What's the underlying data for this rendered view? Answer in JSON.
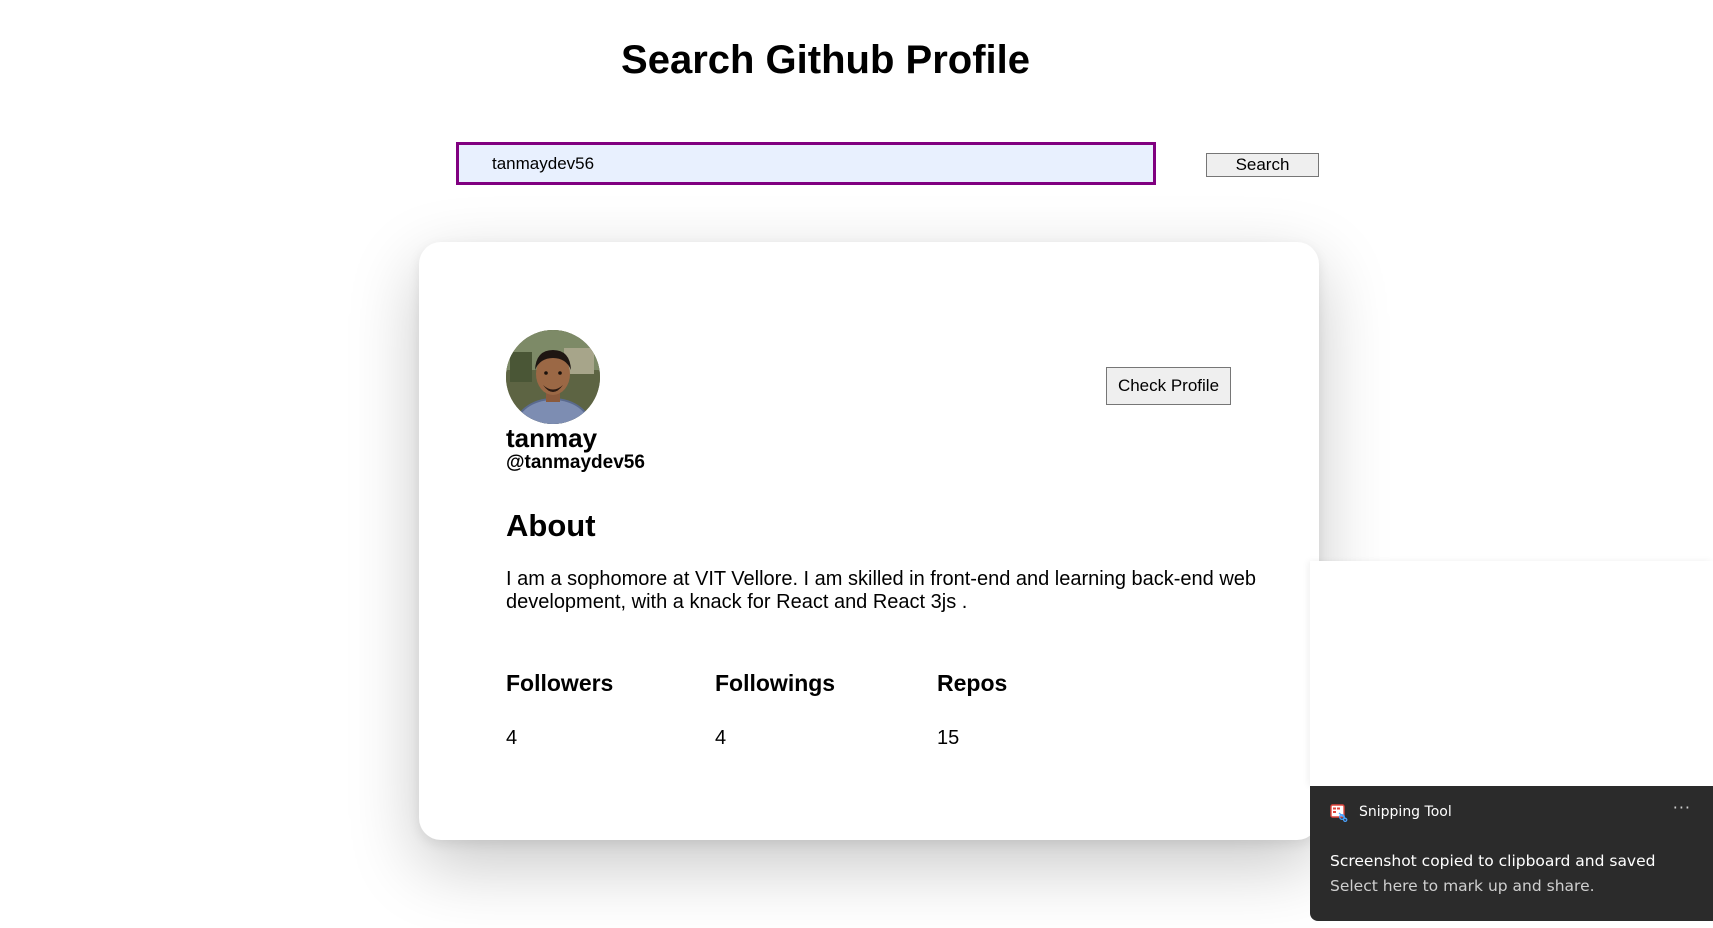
{
  "page": {
    "title": "Search Github Profile"
  },
  "search": {
    "value": "tanmaydev56",
    "button_label": "Search"
  },
  "profile": {
    "name": "tanmay",
    "login": "@tanmaydev56",
    "check_button_label": "Check Profile",
    "avatar_icon": "user-avatar-photo",
    "about_heading": "About",
    "about_text": "I am a sophomore at VIT Vellore. I am skilled in front-end and learning back-end web development, with a knack for React and React 3js .",
    "stats": {
      "followers_label": "Followers",
      "followers_value": "4",
      "followings_label": "Followings",
      "followings_value": "4",
      "repos_label": "Repos",
      "repos_value": "15"
    }
  },
  "toast": {
    "app_name": "Snipping Tool",
    "app_icon": "snipping-tool-icon",
    "more_icon": "more-horizontal-icon",
    "more_glyph": "···",
    "title": "Screenshot copied to clipboard and saved",
    "subtitle": "Select here to mark up and share."
  },
  "colors": {
    "input_border": "#800080",
    "input_background": "#e8f0fe",
    "toast_background": "#2b2b2b"
  }
}
